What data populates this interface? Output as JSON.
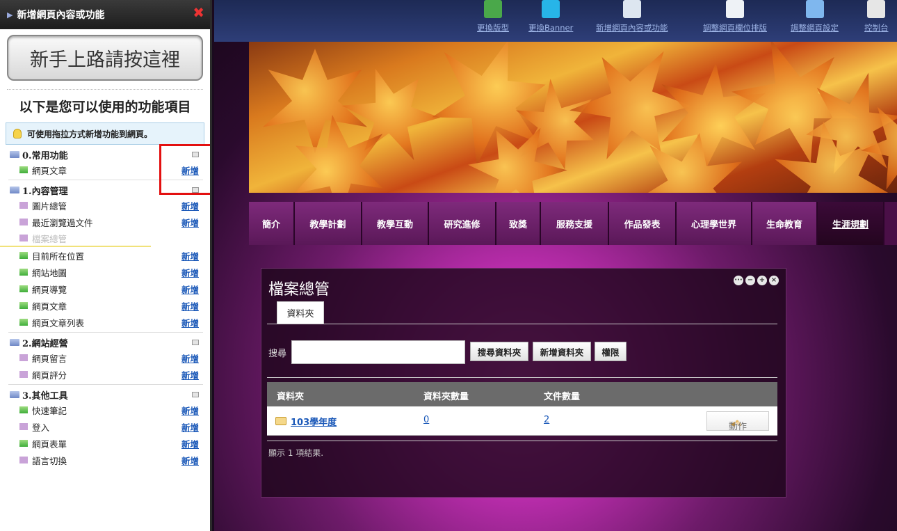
{
  "sidebar": {
    "header": "新增網頁內容或功能",
    "close_glyph": "✖",
    "newbie_button": "新手上路請按這裡",
    "available_title": "以下是您可以使用的功能項目",
    "tip": "可使用拖拉方式新增功能到網頁。",
    "groups": [
      {
        "title": "0.常用功能",
        "items": [
          {
            "label": "網頁文章",
            "icon": "green",
            "add": "新增"
          }
        ]
      },
      {
        "title": "1.內容管理",
        "items": [
          {
            "label": "圖片總管",
            "icon": "purple",
            "add": "新增"
          },
          {
            "label": "最近瀏覽過文件",
            "icon": "purple",
            "add": "新增"
          },
          {
            "label": "檔案總管",
            "icon": "purple",
            "add": "",
            "ghost": true
          },
          {
            "label": "目前所在位置",
            "icon": "green",
            "add": "新增"
          },
          {
            "label": "網站地圖",
            "icon": "green",
            "add": "新增"
          },
          {
            "label": "網頁導覽",
            "icon": "green",
            "add": "新增"
          },
          {
            "label": "網頁文章",
            "icon": "green",
            "add": "新增"
          },
          {
            "label": "網頁文章列表",
            "icon": "green",
            "add": "新增"
          }
        ]
      },
      {
        "title": "2.網站經營",
        "items": [
          {
            "label": "網頁留言",
            "icon": "purple",
            "add": "新增"
          },
          {
            "label": "網頁評分",
            "icon": "purple",
            "add": "新增"
          }
        ]
      },
      {
        "title": "3.其他工具",
        "items": [
          {
            "label": "快速筆記",
            "icon": "green",
            "add": "新增"
          },
          {
            "label": "登入",
            "icon": "purple",
            "add": "新增"
          },
          {
            "label": "網頁表單",
            "icon": "green",
            "add": "新增"
          },
          {
            "label": "語言切換",
            "icon": "purple",
            "add": "新增"
          }
        ]
      }
    ]
  },
  "toolbar": {
    "items": [
      {
        "label": "更換版型",
        "icon": "template-icon",
        "color": "#4aa84a"
      },
      {
        "label": "更換Banner",
        "icon": "banner-icon",
        "color": "#27b5e8"
      },
      {
        "label": "新增網頁內容或功能",
        "icon": "add-content-icon",
        "color": "#dde6f0"
      },
      {
        "label": "調整網頁欄位排版",
        "icon": "layout-icon",
        "color": "#eef2f6"
      },
      {
        "label": "調整網頁設定",
        "icon": "settings-icon",
        "color": "#7fb7ee"
      },
      {
        "label": "控制台",
        "icon": "tools-icon",
        "color": "#e6e6e6"
      }
    ]
  },
  "nav": {
    "tabs": [
      "簡介",
      "教學計劃",
      "教學互動",
      "研究進修",
      "致獎",
      "服務支援",
      "作品發表",
      "心理學世界",
      "生命教育",
      "生涯規劃"
    ],
    "active": 9
  },
  "file_panel": {
    "title": "檔案總管",
    "controls": [
      "···",
      "−",
      "+",
      "×"
    ],
    "tab": "資料夾",
    "search_label": "搜尋",
    "search_value": "",
    "buttons": [
      "搜尋資料夾",
      "新增資料夾",
      "權限"
    ],
    "columns": [
      "資料夾",
      "資料夾數量",
      "文件數量"
    ],
    "rows": [
      {
        "name": "103學年度",
        "folders": "0",
        "files": "2",
        "action": "動作"
      }
    ],
    "result_text": "顯示 1 項結果."
  }
}
